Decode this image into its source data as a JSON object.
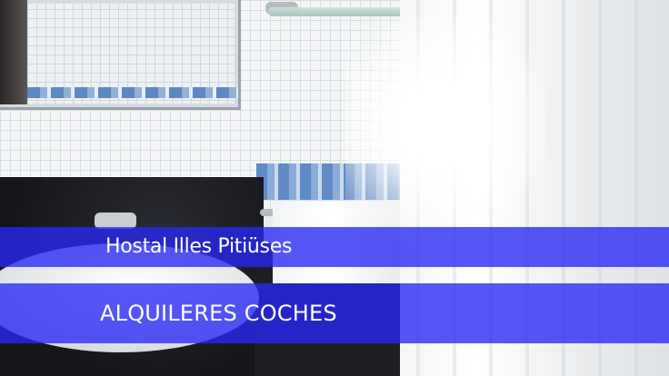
{
  "hotel_banner": {
    "label": "Hostal Illes Pitiüses"
  },
  "cars_banner": {
    "label": "ALQUILERES COCHES"
  },
  "colors": {
    "banner_blue": "#2828f5",
    "banner_text": "#ffffff"
  }
}
